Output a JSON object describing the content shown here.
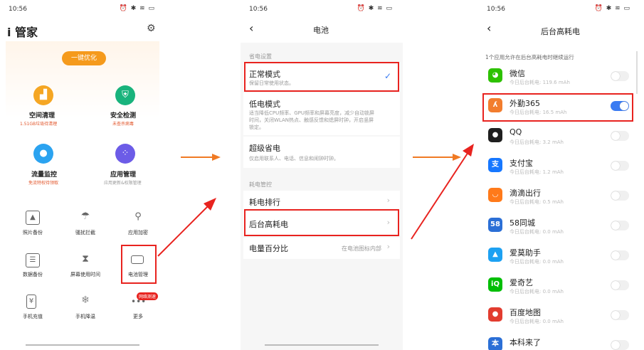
{
  "status": {
    "time": "10:56",
    "icons": "⏰ ✱ ≋ ▭"
  },
  "p1": {
    "title": "i 管家",
    "onekey": "一键优化",
    "tiles": [
      {
        "label": "空间清理",
        "sub": "1.51GB垃圾待清理"
      },
      {
        "label": "安全检测",
        "sub": "未查杀病毒"
      },
      {
        "label": "流量监控",
        "sub": "免流特权待领取"
      },
      {
        "label": "应用管理",
        "sub": "应用更新&权限管理"
      }
    ],
    "grid": [
      "照片备份",
      "骚扰拦截",
      "应用加密",
      "数据备份",
      "屏幕使用时间",
      "电池管理",
      "手机充值",
      "手机降温",
      "更多"
    ],
    "badge": "网络测速"
  },
  "p2": {
    "title": "电池",
    "section1": "省电设置",
    "normal": {
      "label": "正常模式",
      "sub": "保留日常使用状态。"
    },
    "low": {
      "label": "低电模式",
      "sub": "适当降低CPU频率、GPU频率和屏幕亮度，减少自动锁屏时间，关闭WLAN热点、触感反馈和熄屏时钟，开启竖屏锁定。"
    },
    "super": {
      "label": "超级省电",
      "sub": "仅启用联系人、电话、信息和闹钟时钟。"
    },
    "section2": "耗电管控",
    "rank": "耗电排行",
    "background": "后台高耗电",
    "percent": {
      "label": "电量百分比",
      "value": "在电池图标内部"
    }
  },
  "p3": {
    "title": "后台高耗电",
    "note": "1个应用允许在后台高耗电时继续运行",
    "apps": [
      {
        "name": "微信",
        "sub": "今日后台耗电: 119.6 mAh",
        "on": false,
        "color": "#2dc100",
        "glyph": "◕"
      },
      {
        "name": "外勤365",
        "sub": "今日后台耗电: 16.5 mAh",
        "on": true,
        "color": "#f27d2e",
        "glyph": "ʎ"
      },
      {
        "name": "QQ",
        "sub": "今日后台耗电: 3.2 mAh",
        "on": false,
        "color": "#1f1f1f",
        "glyph": "●"
      },
      {
        "name": "支付宝",
        "sub": "今日后台耗电: 1.2 mAh",
        "on": false,
        "color": "#1677ff",
        "glyph": "支"
      },
      {
        "name": "滴滴出行",
        "sub": "今日后台耗电: 0.5 mAh",
        "on": false,
        "color": "#ff7a1a",
        "glyph": "◡"
      },
      {
        "name": "58同城",
        "sub": "今日后台耗电: 0.0 mAh",
        "on": false,
        "color": "#2b6fd6",
        "glyph": "58"
      },
      {
        "name": "爱莫助手",
        "sub": "今日后台耗电: 0.0 mAh",
        "on": false,
        "color": "#1da1f2",
        "glyph": "▲"
      },
      {
        "name": "爱奇艺",
        "sub": "今日后台耗电: 0.0 mAh",
        "on": false,
        "color": "#00be06",
        "glyph": "iQ"
      },
      {
        "name": "百度地图",
        "sub": "今日后台耗电: 0.0 mAh",
        "on": false,
        "color": "#e23c2f",
        "glyph": "●"
      },
      {
        "name": "本科来了",
        "sub": "",
        "on": false,
        "color": "#2b6fd6",
        "glyph": "本"
      }
    ]
  }
}
